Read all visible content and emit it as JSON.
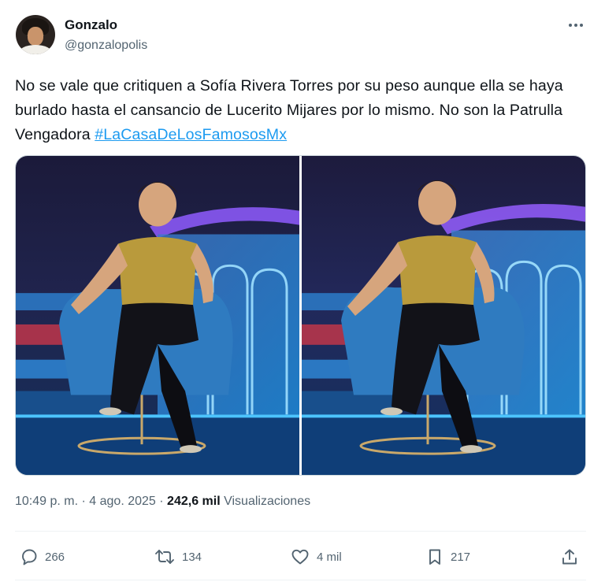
{
  "author": {
    "display_name": "Gonzalo",
    "handle": "@gonzalopolis"
  },
  "tweet": {
    "text_before": "No se vale que critiquen a Sofía Rivera Torres por su peso aunque ella se haya burlado hasta el cansancio de Lucerito Mijares por lo mismo. No son la Patrulla Vengadora ",
    "hashtag": "#LaCasaDeLosFamososMx"
  },
  "media": {
    "count": 2
  },
  "meta": {
    "time": "10:49 p. m.",
    "separator": "·",
    "date": "4 ago. 2025",
    "views_count": "242,6 mil",
    "views_label": "Visualizaciones"
  },
  "actions": {
    "replies": "266",
    "reposts": "134",
    "likes": "4 mil",
    "bookmarks": "217"
  },
  "icons": {
    "more": "more-horizontal-icon",
    "reply": "speech-bubble-icon",
    "repost": "repost-arrows-icon",
    "like": "heart-icon",
    "bookmark": "bookmark-icon",
    "share": "share-upload-icon"
  },
  "colors": {
    "text_primary": "#0f1419",
    "text_secondary": "#536471",
    "link": "#1d9bf0"
  }
}
